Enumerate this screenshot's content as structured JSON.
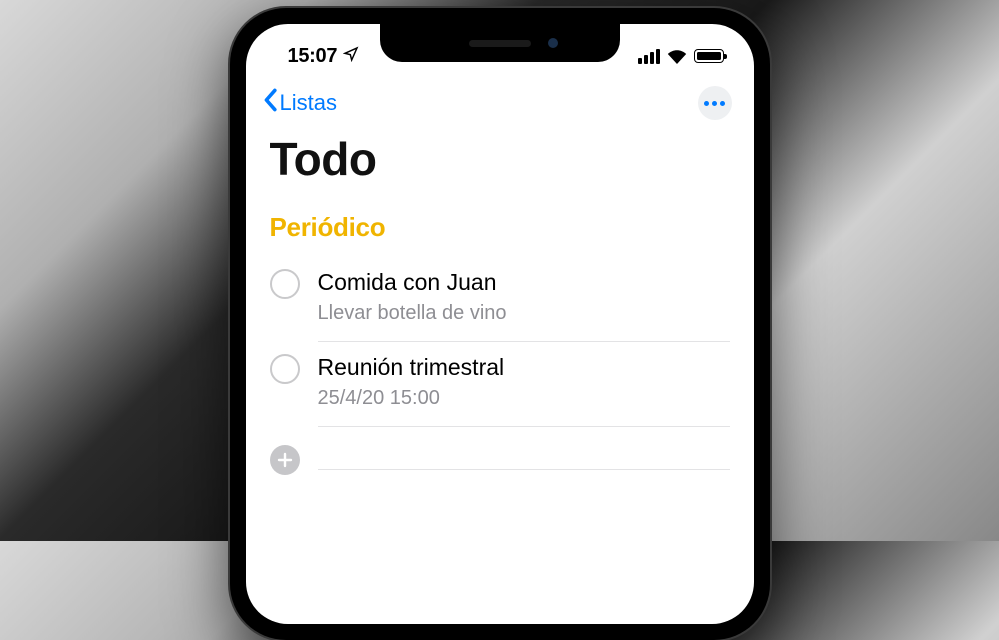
{
  "status": {
    "time": "15:07"
  },
  "nav": {
    "back_label": "Listas"
  },
  "page": {
    "title": "Todo"
  },
  "section": {
    "header": "Periódico"
  },
  "reminders": [
    {
      "title": "Comida con Juan",
      "subtitle": "Llevar botella de vino"
    },
    {
      "title": "Reunión trimestral",
      "subtitle": "25/4/20 15:00"
    }
  ]
}
